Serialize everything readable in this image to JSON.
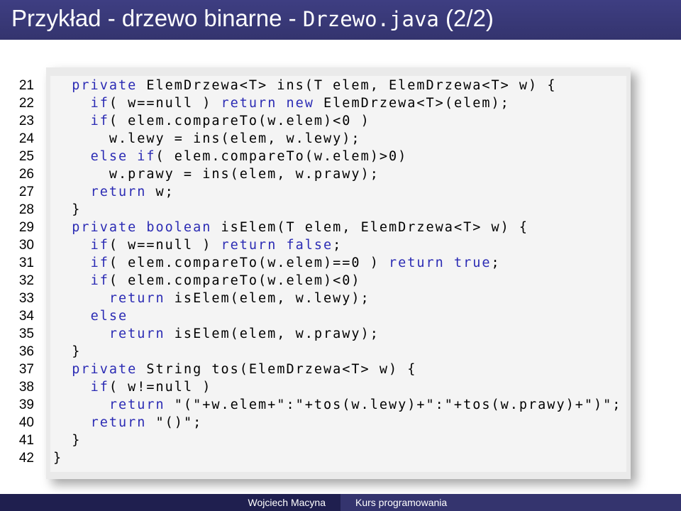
{
  "slide": {
    "title_prefix": "Przykład - drzewo binarne - ",
    "title_file": "Drzewo.java",
    "title_suffix": " (2/2)"
  },
  "code": {
    "lines": [
      {
        "n": "21",
        "indent": "  ",
        "segs": [
          {
            "t": "private",
            "k": true
          },
          {
            "t": " ElemDrzewa<T> ins(T elem, ElemDrzewa<T> w) {"
          }
        ]
      },
      {
        "n": "22",
        "indent": "    ",
        "segs": [
          {
            "t": "if",
            "k": true
          },
          {
            "t": "( w==null ) "
          },
          {
            "t": "return new",
            "k": true
          },
          {
            "t": " ElemDrzewa<T>(elem);"
          }
        ]
      },
      {
        "n": "23",
        "indent": "    ",
        "segs": [
          {
            "t": "if",
            "k": true
          },
          {
            "t": "( elem.compareTo(w.elem)<0 )"
          }
        ]
      },
      {
        "n": "24",
        "indent": "      ",
        "segs": [
          {
            "t": "w.lewy = ins(elem, w.lewy);"
          }
        ]
      },
      {
        "n": "25",
        "indent": "    ",
        "segs": [
          {
            "t": "else if",
            "k": true
          },
          {
            "t": "( elem.compareTo(w.elem)>0)"
          }
        ]
      },
      {
        "n": "26",
        "indent": "      ",
        "segs": [
          {
            "t": "w.prawy = ins(elem, w.prawy);"
          }
        ]
      },
      {
        "n": "27",
        "indent": "    ",
        "segs": [
          {
            "t": "return",
            "k": true
          },
          {
            "t": " w;"
          }
        ]
      },
      {
        "n": "28",
        "indent": "  ",
        "segs": [
          {
            "t": "}"
          }
        ]
      },
      {
        "n": "29",
        "indent": "  ",
        "segs": [
          {
            "t": "private boolean",
            "k": true
          },
          {
            "t": " isElem(T elem, ElemDrzewa<T> w) {"
          }
        ]
      },
      {
        "n": "30",
        "indent": "    ",
        "segs": [
          {
            "t": "if",
            "k": true
          },
          {
            "t": "( w==null ) "
          },
          {
            "t": "return false",
            "k": true
          },
          {
            "t": ";"
          }
        ]
      },
      {
        "n": "31",
        "indent": "    ",
        "segs": [
          {
            "t": "if",
            "k": true
          },
          {
            "t": "( elem.compareTo(w.elem)==0 ) "
          },
          {
            "t": "return true",
            "k": true
          },
          {
            "t": ";"
          }
        ]
      },
      {
        "n": "32",
        "indent": "    ",
        "segs": [
          {
            "t": "if",
            "k": true
          },
          {
            "t": "( elem.compareTo(w.elem)<0)"
          }
        ]
      },
      {
        "n": "33",
        "indent": "      ",
        "segs": [
          {
            "t": "return",
            "k": true
          },
          {
            "t": " isElem(elem, w.lewy);"
          }
        ]
      },
      {
        "n": "34",
        "indent": "    ",
        "segs": [
          {
            "t": "else",
            "k": true
          }
        ]
      },
      {
        "n": "35",
        "indent": "      ",
        "segs": [
          {
            "t": "return",
            "k": true
          },
          {
            "t": " isElem(elem, w.prawy);"
          }
        ]
      },
      {
        "n": "36",
        "indent": "  ",
        "segs": [
          {
            "t": "}"
          }
        ]
      },
      {
        "n": "37",
        "indent": "  ",
        "segs": [
          {
            "t": "private",
            "k": true
          },
          {
            "t": " String tos(ElemDrzewa<T> w) {"
          }
        ]
      },
      {
        "n": "38",
        "indent": "    ",
        "segs": [
          {
            "t": "if",
            "k": true
          },
          {
            "t": "( w!=null )"
          }
        ]
      },
      {
        "n": "39",
        "indent": "      ",
        "segs": [
          {
            "t": "return",
            "k": true
          },
          {
            "t": " \"(\"+w.elem+\":\"+tos(w.lewy)+\":\"+tos(w.prawy)+\")\";"
          }
        ]
      },
      {
        "n": "40",
        "indent": "    ",
        "segs": [
          {
            "t": "return",
            "k": true
          },
          {
            "t": " \"()\";"
          }
        ]
      },
      {
        "n": "41",
        "indent": "  ",
        "segs": [
          {
            "t": "}"
          }
        ]
      },
      {
        "n": "42",
        "indent": "",
        "segs": [
          {
            "t": "}"
          }
        ]
      }
    ]
  },
  "footer": {
    "author": "Wojciech Macyna",
    "course": "Kurs programowania"
  }
}
